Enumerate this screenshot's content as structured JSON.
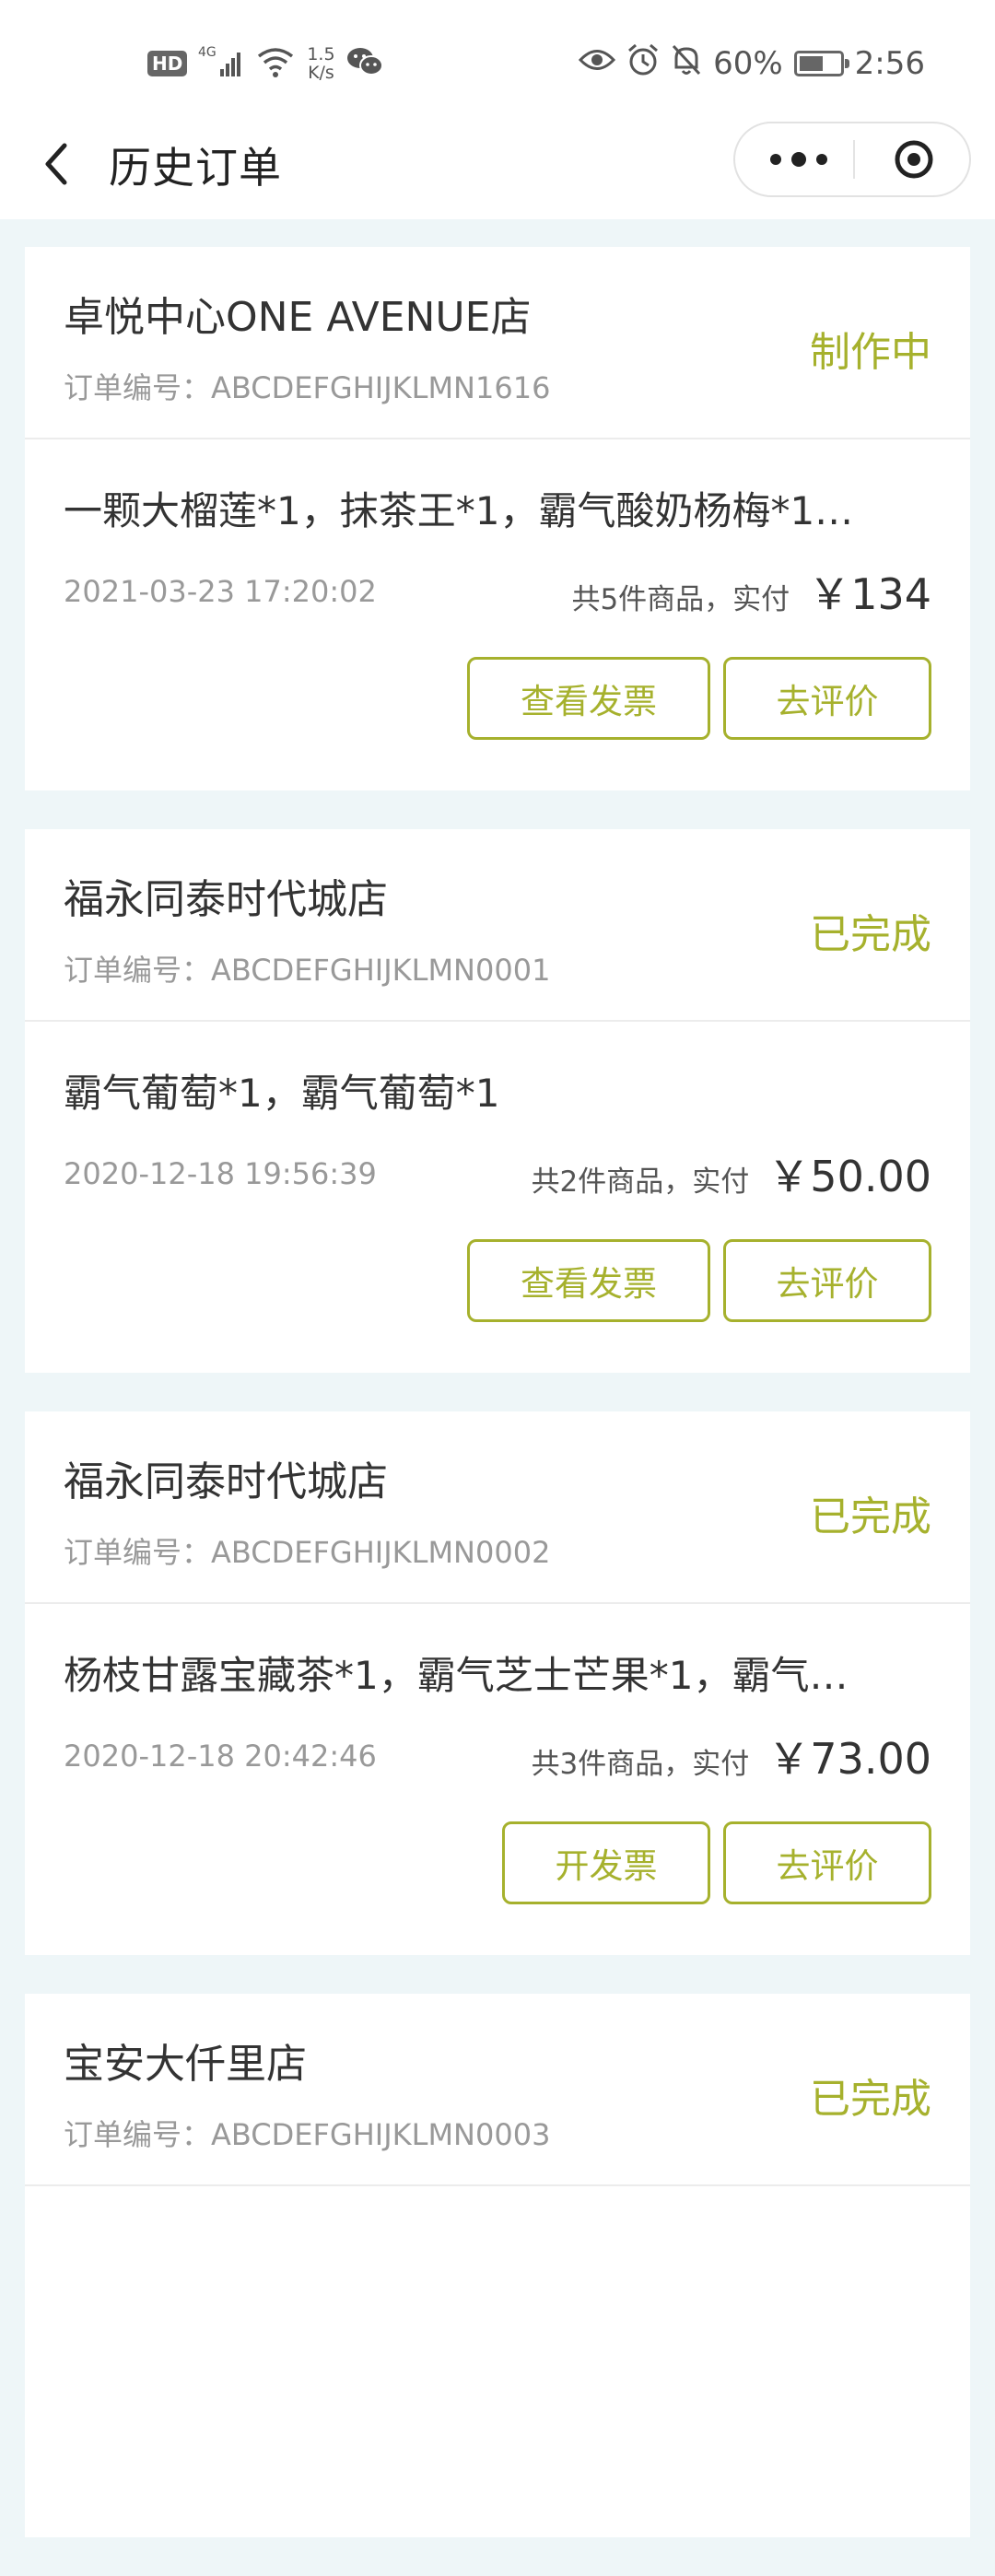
{
  "status_bar": {
    "hd": "HD",
    "signal": "4G",
    "speed_value": "1.5",
    "speed_unit": "K/s",
    "battery": "60%",
    "battery_level": 0.6,
    "time": "2:56"
  },
  "nav": {
    "title": "历史订单"
  },
  "orders": [
    {
      "store": "卓悦中心ONE AVENUE店",
      "order_no": "订单编号：ABCDEFGHIJKLMN1616",
      "status": "制作中",
      "items": "一颗大榴莲*1，抹茶王*1，霸气酸奶杨梅*1…",
      "time": "2021-03-23 17:20:02",
      "count": "共5件商品，实付",
      "amount": "￥134",
      "buttons": [
        "查看发票",
        "去评价"
      ]
    },
    {
      "store": "福永同泰时代城店",
      "order_no": "订单编号：ABCDEFGHIJKLMN0001",
      "status": "已完成",
      "items": "霸气葡萄*1，霸气葡萄*1",
      "time": "2020-12-18 19:56:39",
      "count": "共2件商品，实付",
      "amount": "￥50.00",
      "buttons": [
        "查看发票",
        "去评价"
      ]
    },
    {
      "store": "福永同泰时代城店",
      "order_no": "订单编号：ABCDEFGHIJKLMN0002",
      "status": "已完成",
      "items": "杨枝甘露宝藏茶*1，霸气芝士芒果*1，霸气…",
      "time": "2020-12-18 20:42:46",
      "count": "共3件商品，实付",
      "amount": "￥73.00",
      "buttons": [
        "开发票",
        "去评价"
      ]
    },
    {
      "store": "宝安大仟里店",
      "order_no": "订单编号：ABCDEFGHIJKLMN0003",
      "status": "已完成"
    }
  ],
  "colors": {
    "accent": "#a6b12d",
    "background": "#eef6f8"
  }
}
